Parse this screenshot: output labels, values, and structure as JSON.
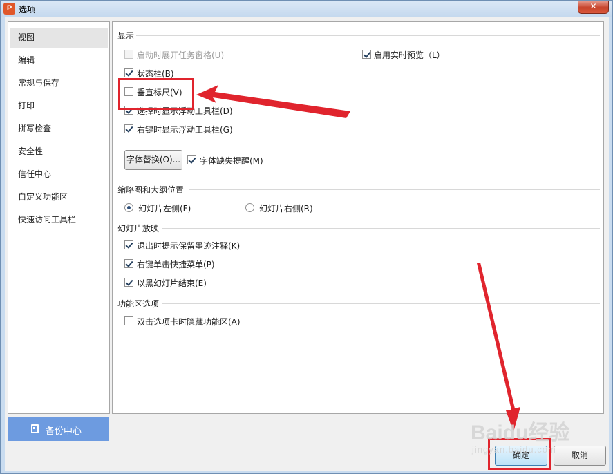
{
  "window": {
    "title": "选项",
    "close_glyph": "✕",
    "app_icon_letter": "P"
  },
  "sidebar": {
    "items": [
      {
        "label": "视图",
        "active": true
      },
      {
        "label": "编辑"
      },
      {
        "label": "常规与保存"
      },
      {
        "label": "打印"
      },
      {
        "label": "拼写检查"
      },
      {
        "label": "安全性"
      },
      {
        "label": "信任中心"
      },
      {
        "label": "自定义功能区"
      },
      {
        "label": "快速访问工具栏"
      }
    ],
    "backup_label": "备份中心"
  },
  "content": {
    "display": {
      "title": "显示",
      "startup_task_pane": {
        "label": "启动时展开任务窗格(U)",
        "checked": false,
        "disabled": true
      },
      "live_preview": {
        "label": "启用实时预览（L）",
        "checked": true
      },
      "status_bar": {
        "label": "状态栏(B)",
        "checked": true
      },
      "vertical_ruler": {
        "label": "垂直标尺(V)",
        "checked": false
      },
      "float_toolbar_select": {
        "label": "选择时显示浮动工具栏(D)",
        "checked": true
      },
      "float_toolbar_rightclick": {
        "label": "右键时显示浮动工具栏(G)",
        "checked": true
      },
      "font_replace_button": "字体替换(O)...",
      "font_missing_warning": {
        "label": "字体缺失提醒(M)",
        "checked": true
      }
    },
    "thumbnail": {
      "title": "缩略图和大纲位置",
      "left": {
        "label": "幻灯片左侧(F)",
        "selected": true
      },
      "right": {
        "label": "幻灯片右侧(R)",
        "selected": false
      }
    },
    "slideshow": {
      "title": "幻灯片放映",
      "ink_prompt": {
        "label": "退出时提示保留墨迹注释(K)",
        "checked": true
      },
      "right_click_menu": {
        "label": "右键单击快捷菜单(P)",
        "checked": true
      },
      "end_black": {
        "label": "以黑幻灯片结束(E)",
        "checked": true
      }
    },
    "ribbon": {
      "title": "功能区选项",
      "dblclick_hide": {
        "label": "双击选项卡时隐藏功能区(A)",
        "checked": false
      }
    }
  },
  "footer": {
    "ok_label": "确定",
    "cancel_label": "取消"
  },
  "watermark": {
    "brand": "Baidu经验",
    "sub": "jingyan.baidu.com"
  },
  "colors": {
    "annotation_red": "#e0242d",
    "backup_blue": "#6d9be0"
  }
}
